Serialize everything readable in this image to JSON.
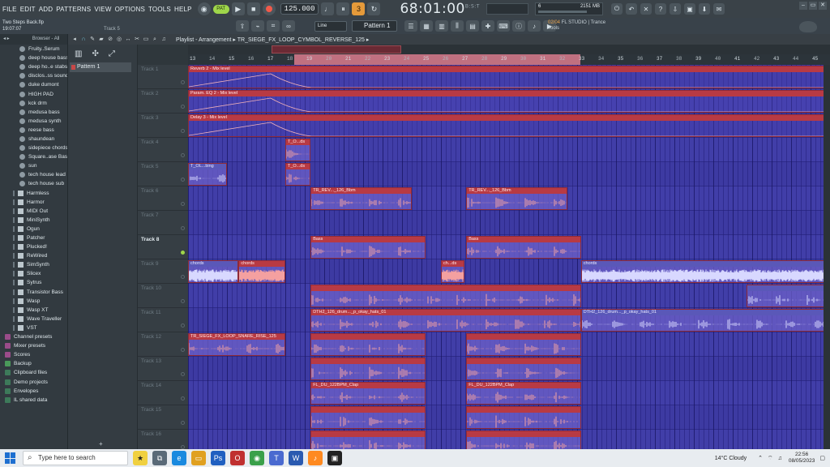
{
  "menu": [
    "FILE",
    "EDIT",
    "ADD",
    "PATTERNS",
    "VIEW",
    "OPTIONS",
    "TOOLS",
    "HELP"
  ],
  "transport": {
    "mode_label": "PAT",
    "tempo": "125.000",
    "time": "68:01:00",
    "time_unit": "B:S:T"
  },
  "meters": {
    "cpu": "6",
    "memory": "2151 MB"
  },
  "project": {
    "name": "Two Steps Back.flp",
    "timestamp": "19:07:07",
    "hint": "Track 5"
  },
  "snap": "Line",
  "pattern_select": "Pattern 1",
  "news": {
    "date": "02/04",
    "text": "FL STUDIO | Trance",
    "sub": "Tools"
  },
  "browser": {
    "header": "Browser - All",
    "items": [
      {
        "label": "Fruity..Serum",
        "kind": "sample"
      },
      {
        "label": "deep house bass",
        "kind": "sample"
      },
      {
        "label": "deep ho..e stabs",
        "kind": "sample"
      },
      {
        "label": "disclos..ss sound",
        "kind": "sample"
      },
      {
        "label": "duke dumont",
        "kind": "sample"
      },
      {
        "label": "HIGH PAD",
        "kind": "sample"
      },
      {
        "label": "kck drm",
        "kind": "sample"
      },
      {
        "label": "medusa bass",
        "kind": "sample"
      },
      {
        "label": "medusa synth",
        "kind": "sample"
      },
      {
        "label": "reese bass",
        "kind": "sample"
      },
      {
        "label": "shaundean",
        "kind": "sample"
      },
      {
        "label": "sidepiece chords",
        "kind": "sample"
      },
      {
        "label": "Square..ase Bass",
        "kind": "sample"
      },
      {
        "label": "sun",
        "kind": "sample"
      },
      {
        "label": "tech house lead",
        "kind": "sample"
      },
      {
        "label": "tech house sub",
        "kind": "sample"
      },
      {
        "label": "Harmless",
        "kind": "plugin"
      },
      {
        "label": "Harmor",
        "kind": "plugin"
      },
      {
        "label": "MIDI Out",
        "kind": "plugin"
      },
      {
        "label": "MiniSynth",
        "kind": "plugin"
      },
      {
        "label": "Ogun",
        "kind": "plugin"
      },
      {
        "label": "Patcher",
        "kind": "plugin"
      },
      {
        "label": "Plucked!",
        "kind": "plugin"
      },
      {
        "label": "ReWired",
        "kind": "plugin"
      },
      {
        "label": "SimSynth",
        "kind": "plugin"
      },
      {
        "label": "Slicex",
        "kind": "plugin"
      },
      {
        "label": "Sytrus",
        "kind": "plugin"
      },
      {
        "label": "Transistor Bass",
        "kind": "plugin"
      },
      {
        "label": "Wasp",
        "kind": "plugin"
      },
      {
        "label": "Wasp XT",
        "kind": "plugin"
      },
      {
        "label": "Wave Traveller",
        "kind": "plugin"
      },
      {
        "label": "VST",
        "kind": "plugin"
      },
      {
        "label": "Channel presets",
        "kind": "folder-pink"
      },
      {
        "label": "Mixer presets",
        "kind": "folder-pink"
      },
      {
        "label": "Scores",
        "kind": "folder-pink"
      },
      {
        "label": "Backup",
        "kind": "folder-green"
      },
      {
        "label": "Clipboard files",
        "kind": "folder"
      },
      {
        "label": "Demo projects",
        "kind": "folder"
      },
      {
        "label": "Envelopes",
        "kind": "folder"
      },
      {
        "label": "IL shared data",
        "kind": "folder"
      }
    ]
  },
  "playlist": {
    "title": "Playlist - Arrangement",
    "breadcrumb": "TR_SIEGE_FX_LOOP_CYMBOL_REVERSE_125",
    "pattern": "Pattern 1",
    "tracks": [
      "Track 1",
      "Track 2",
      "Track 3",
      "Track 4",
      "Track 5",
      "Track 6",
      "Track 7",
      "Track 8",
      "Track 9",
      "Track 10",
      "Track 11",
      "Track 12",
      "Track 13",
      "Track 14",
      "Track 15",
      "Track 16"
    ],
    "active_track": 7,
    "bars": [
      13,
      14,
      15,
      16,
      17,
      18,
      19,
      20,
      21,
      22,
      23,
      24,
      25,
      26,
      27,
      28,
      29,
      30,
      31,
      32,
      33,
      34,
      35,
      36,
      37,
      38,
      39,
      40,
      41,
      42,
      43,
      44,
      45
    ],
    "labeled_bars": [
      "13",
      "15",
      "17",
      "19",
      "21",
      "23",
      "25",
      "27",
      "29",
      "31",
      "33",
      "35",
      "37",
      "39",
      "41",
      "43",
      "45"
    ],
    "clips": [
      {
        "row": 0,
        "start": 13,
        "end": 46,
        "label": "Reverb 2 - Mix level",
        "type": "auto"
      },
      {
        "row": 1,
        "start": 13,
        "end": 46,
        "label": "Param. EQ 2 - Mix level",
        "type": "auto"
      },
      {
        "row": 2,
        "start": 13,
        "end": 46,
        "label": "Delay 3 - Mix level",
        "type": "auto"
      },
      {
        "row": 3,
        "start": 18,
        "end": 19.3,
        "label": "T_O...ds",
        "type": "clip"
      },
      {
        "row": 4,
        "start": 13,
        "end": 15,
        "label": "T_OL...bing",
        "type": "blue"
      },
      {
        "row": 4,
        "start": 18,
        "end": 19.3,
        "label": "T_O...ds",
        "type": "clip"
      },
      {
        "row": 5,
        "start": 19.3,
        "end": 24.5,
        "label": "TR_REV..._126_Bbm",
        "type": "clip"
      },
      {
        "row": 5,
        "start": 27.3,
        "end": 32.5,
        "label": "TR_REV..._126_Bbm",
        "type": "clip"
      },
      {
        "row": 7,
        "start": 19.3,
        "end": 25.2,
        "label": "Bass",
        "type": "clip"
      },
      {
        "row": 7,
        "start": 27.3,
        "end": 33.2,
        "label": "Bass",
        "type": "clip"
      },
      {
        "row": 8,
        "start": 13,
        "end": 15.6,
        "label": "chords",
        "type": "blue"
      },
      {
        "row": 8,
        "start": 15.6,
        "end": 18,
        "label": "chords",
        "type": "clip"
      },
      {
        "row": 8,
        "start": 26,
        "end": 27.2,
        "label": "ch...ds",
        "type": "clip"
      },
      {
        "row": 8,
        "start": 33.2,
        "end": 46,
        "label": "chords",
        "type": "blue"
      },
      {
        "row": 9,
        "start": 19.3,
        "end": 33.2,
        "label": "",
        "type": "clip"
      },
      {
        "row": 9,
        "start": 41.7,
        "end": 46,
        "label": "",
        "type": "blue"
      },
      {
        "row": 10,
        "start": 19.3,
        "end": 33.2,
        "label": "DTH2_126_drum..._p_okay_hats_01",
        "type": "clip"
      },
      {
        "row": 10,
        "start": 33.2,
        "end": 46,
        "label": "DTH2_126_drum..._p_okay_hats_01",
        "type": "blue"
      },
      {
        "row": 11,
        "start": 13,
        "end": 18,
        "label": "TR_SIEGE_FX_LOOP_SNARE_RISE_125",
        "type": "clip"
      },
      {
        "row": 11,
        "start": 19.3,
        "end": 25.2,
        "label": "",
        "type": "clip"
      },
      {
        "row": 11,
        "start": 27.3,
        "end": 33.2,
        "label": "",
        "type": "clip"
      },
      {
        "row": 12,
        "start": 19.3,
        "end": 25.2,
        "label": "",
        "type": "clip"
      },
      {
        "row": 12,
        "start": 27.3,
        "end": 33.2,
        "label": "",
        "type": "clip"
      },
      {
        "row": 13,
        "start": 19.3,
        "end": 25.2,
        "label": "FL_DU_122BPM_Clap",
        "type": "clip"
      },
      {
        "row": 13,
        "start": 27.3,
        "end": 33.2,
        "label": "FL_DU_122BPM_Clap",
        "type": "clip"
      },
      {
        "row": 14,
        "start": 19.3,
        "end": 25.2,
        "label": "",
        "type": "clip"
      },
      {
        "row": 14,
        "start": 27.3,
        "end": 33.2,
        "label": "",
        "type": "clip"
      },
      {
        "row": 15,
        "start": 19.3,
        "end": 25.2,
        "label": "",
        "type": "clip"
      },
      {
        "row": 15,
        "start": 27.3,
        "end": 33.2,
        "label": "",
        "type": "clip"
      }
    ]
  },
  "taskbar": {
    "search_placeholder": "Type here to search",
    "weather": "14°C  Cloudy",
    "time": "22:56",
    "date": "08/05/2023"
  },
  "colors": {
    "grid": "#3d3aa2",
    "clip_title": "#b83a44",
    "clip_body": "#6c60c8",
    "wave": "#f4a0a0",
    "accent_green": "#9fd64a",
    "accent_orange": "#e59a3a"
  }
}
